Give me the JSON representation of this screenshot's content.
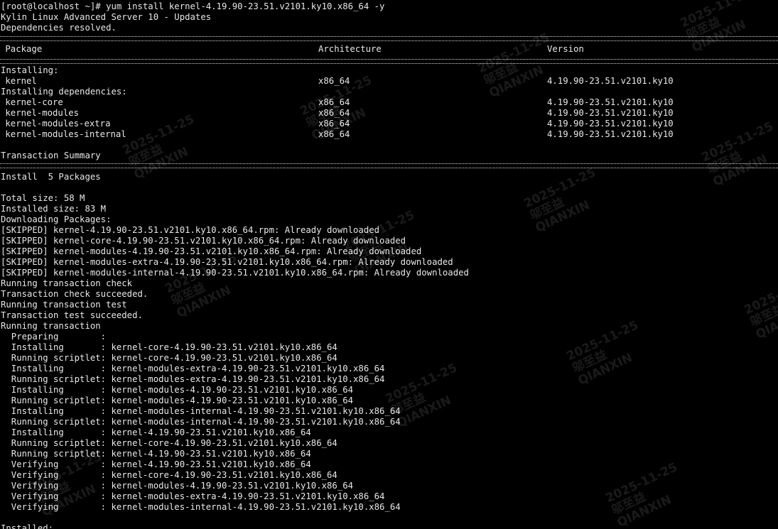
{
  "terminal": {
    "prompt_line": "[root@localhost ~]# yum install kernel-4.19.90-23.51.v2101.ky10.x86_64 -y",
    "repo_line": "Kylin Linux Advanced Server 10 - Updates",
    "deps_resolved": "Dependencies resolved.",
    "table": {
      "headers": {
        "package": " Package",
        "architecture": "Architecture",
        "version": "Version"
      },
      "installing_label": "Installing:",
      "installing_rows": [
        {
          "package": " kernel",
          "arch": "x86_64",
          "version": "4.19.90-23.51.v2101.ky10"
        }
      ],
      "deps_label": "Installing dependencies:",
      "dep_rows": [
        {
          "package": " kernel-core",
          "arch": "x86_64",
          "version": "4.19.90-23.51.v2101.ky10"
        },
        {
          "package": " kernel-modules",
          "arch": "x86_64",
          "version": "4.19.90-23.51.v2101.ky10"
        },
        {
          "package": " kernel-modules-extra",
          "arch": "x86_64",
          "version": "4.19.90-23.51.v2101.ky10"
        },
        {
          "package": " kernel-modules-internal",
          "arch": "x86_64",
          "version": "4.19.90-23.51.v2101.ky10"
        }
      ]
    },
    "summary_title": "Transaction Summary",
    "install_count": "Install  5 Packages",
    "total_size": "Total size: 58 M",
    "installed_size": "Installed size: 83 M",
    "downloading": "Downloading Packages:",
    "skipped": [
      "[SKIPPED] kernel-4.19.90-23.51.v2101.ky10.x86_64.rpm: Already downloaded",
      "[SKIPPED] kernel-core-4.19.90-23.51.v2101.ky10.x86_64.rpm: Already downloaded",
      "[SKIPPED] kernel-modules-4.19.90-23.51.v2101.ky10.x86_64.rpm: Already downloaded",
      "[SKIPPED] kernel-modules-extra-4.19.90-23.51.v2101.ky10.x86_64.rpm: Already downloaded",
      "[SKIPPED] kernel-modules-internal-4.19.90-23.51.v2101.ky10.x86_64.rpm: Already downloaded"
    ],
    "checks": [
      "Running transaction check",
      "Transaction check succeeded.",
      "Running transaction test",
      "Transaction test succeeded.",
      "Running transaction"
    ],
    "steps": [
      "  Preparing        :",
      "  Installing       : kernel-core-4.19.90-23.51.v2101.ky10.x86_64",
      "  Running scriptlet: kernel-core-4.19.90-23.51.v2101.ky10.x86_64",
      "  Installing       : kernel-modules-extra-4.19.90-23.51.v2101.ky10.x86_64",
      "  Running scriptlet: kernel-modules-extra-4.19.90-23.51.v2101.ky10.x86_64",
      "  Installing       : kernel-modules-4.19.90-23.51.v2101.ky10.x86_64",
      "  Running scriptlet: kernel-modules-4.19.90-23.51.v2101.ky10.x86_64",
      "  Installing       : kernel-modules-internal-4.19.90-23.51.v2101.ky10.x86_64",
      "  Running scriptlet: kernel-modules-internal-4.19.90-23.51.v2101.ky10.x86_64",
      "  Installing       : kernel-4.19.90-23.51.v2101.ky10.x86_64",
      "  Running scriptlet: kernel-core-4.19.90-23.51.v2101.ky10.x86_64",
      "  Running scriptlet: kernel-4.19.90-23.51.v2101.ky10.x86_64",
      "  Verifying        : kernel-4.19.90-23.51.v2101.ky10.x86_64",
      "  Verifying        : kernel-core-4.19.90-23.51.v2101.ky10.x86_64",
      "  Verifying        : kernel-modules-4.19.90-23.51.v2101.ky10.x86_64",
      "  Verifying        : kernel-modules-extra-4.19.90-23.51.v2101.ky10.x86_64",
      "  Verifying        : kernel-modules-internal-4.19.90-23.51.v2101.ky10.x86_64"
    ],
    "installed_label": "Installed:"
  },
  "watermark": {
    "date": "2025-11-25",
    "name": "邬至益",
    "org": "QIANXIN"
  }
}
